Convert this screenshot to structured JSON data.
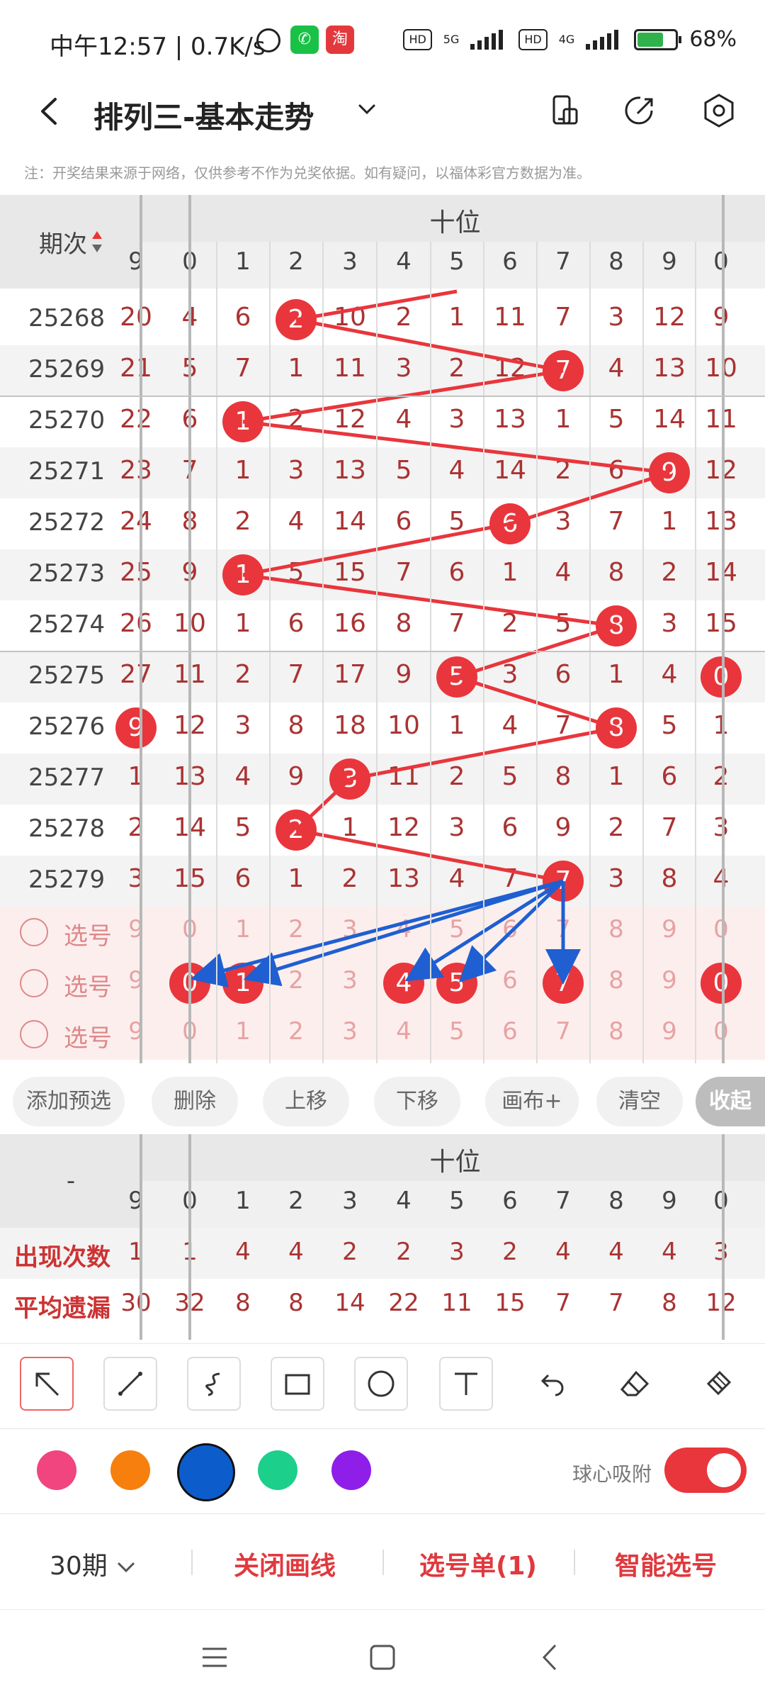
{
  "status": {
    "time": "中午12:57 | 0.7K/s",
    "hd1": "HD",
    "net1": "5G",
    "hd2": "HD",
    "net2": "4G",
    "battery": "68%",
    "wechat_icon": "wechat-icon",
    "taobao_icon": "taobao-icon",
    "taobao_glyph": "淘"
  },
  "header": {
    "title": "排列三-基本走势",
    "note": "注：开奖结果来源于网络，仅供参考不作为兑奖依据。如有疑问，以福体彩官方数据为准。"
  },
  "grid": {
    "period_header": "期次",
    "group_label": "十位",
    "col_headers": [
      "9",
      "0",
      "1",
      "2",
      "3",
      "4",
      "5",
      "6",
      "7",
      "8",
      "9",
      "0"
    ],
    "rows": [
      {
        "pid": "25268",
        "cells": [
          "20",
          "4",
          "6",
          "2",
          "10",
          "2",
          "1",
          "11",
          "7",
          "3",
          "12",
          "9"
        ],
        "hit": 3
      },
      {
        "pid": "25269",
        "cells": [
          "21",
          "5",
          "7",
          "1",
          "11",
          "3",
          "2",
          "12",
          "7",
          "4",
          "13",
          "10"
        ],
        "hit": 8
      },
      {
        "pid": "25270",
        "cells": [
          "22",
          "6",
          "1",
          "2",
          "12",
          "4",
          "3",
          "13",
          "1",
          "5",
          "14",
          "11"
        ],
        "hit": 2
      },
      {
        "pid": "25271",
        "cells": [
          "23",
          "7",
          "1",
          "3",
          "13",
          "5",
          "4",
          "14",
          "2",
          "6",
          "9",
          "12"
        ],
        "hit": 10
      },
      {
        "pid": "25272",
        "cells": [
          "24",
          "8",
          "2",
          "4",
          "14",
          "6",
          "5",
          "6",
          "3",
          "7",
          "1",
          "13"
        ],
        "hit": 7
      },
      {
        "pid": "25273",
        "cells": [
          "25",
          "9",
          "1",
          "5",
          "15",
          "7",
          "6",
          "1",
          "4",
          "8",
          "2",
          "14"
        ],
        "hit": 2
      },
      {
        "pid": "25274",
        "cells": [
          "26",
          "10",
          "1",
          "6",
          "16",
          "8",
          "7",
          "2",
          "5",
          "8",
          "3",
          "15"
        ],
        "hit": 9
      },
      {
        "pid": "25275",
        "cells": [
          "27",
          "11",
          "2",
          "7",
          "17",
          "9",
          "5",
          "3",
          "6",
          "1",
          "4",
          "0"
        ],
        "hit": 6,
        "hit2": 11
      },
      {
        "pid": "25276",
        "cells": [
          "9",
          "12",
          "3",
          "8",
          "18",
          "10",
          "1",
          "4",
          "7",
          "8",
          "5",
          "1"
        ],
        "hit": 9,
        "hit2": 0
      },
      {
        "pid": "25277",
        "cells": [
          "1",
          "13",
          "4",
          "9",
          "3",
          "11",
          "2",
          "5",
          "8",
          "1",
          "6",
          "2"
        ],
        "hit": 4
      },
      {
        "pid": "25278",
        "cells": [
          "2",
          "14",
          "5",
          "2",
          "1",
          "12",
          "3",
          "6",
          "9",
          "2",
          "7",
          "3"
        ],
        "hit": 3
      },
      {
        "pid": "25279",
        "cells": [
          "3",
          "15",
          "6",
          "1",
          "2",
          "13",
          "4",
          "7",
          "7",
          "3",
          "8",
          "4"
        ],
        "hit": 8
      }
    ],
    "pick_label": "选号",
    "pick_cells": [
      "9",
      "0",
      "1",
      "2",
      "3",
      "4",
      "5",
      "6",
      "7",
      "8",
      "9",
      "0"
    ],
    "pick_selected": [
      1,
      2,
      5,
      6,
      8,
      11
    ]
  },
  "actions": [
    "添加预选",
    "删除",
    "上移",
    "下移",
    "画布+",
    "清空",
    "收起"
  ],
  "stats": {
    "corner": "-",
    "group_label": "十位",
    "col_headers": [
      "9",
      "0",
      "1",
      "2",
      "3",
      "4",
      "5",
      "6",
      "7",
      "8",
      "9",
      "0"
    ],
    "rows": [
      {
        "label": "出现次数",
        "cells": [
          "1",
          "1",
          "4",
          "4",
          "2",
          "2",
          "3",
          "2",
          "4",
          "4",
          "4",
          "3"
        ]
      },
      {
        "label": "平均遗漏",
        "cells": [
          "30",
          "32",
          "8",
          "8",
          "14",
          "22",
          "11",
          "15",
          "7",
          "7",
          "8",
          "12"
        ]
      }
    ]
  },
  "tools": [
    "select-arrow-icon",
    "line-icon",
    "curve-icon",
    "rectangle-icon",
    "circle-icon",
    "text-icon",
    "undo-icon",
    "eraser-icon",
    "clear-brush-icon"
  ],
  "colors": [
    "#f0457f",
    "#f77f0e",
    "#0c5ccc",
    "#1ccf8b",
    "#8e1ee8"
  ],
  "snap_label": "球心吸附",
  "bottom": {
    "period": "30期",
    "close_lines": "关闭画线",
    "pick_list": "选号单(1)",
    "smart_pick": "智能选号"
  }
}
